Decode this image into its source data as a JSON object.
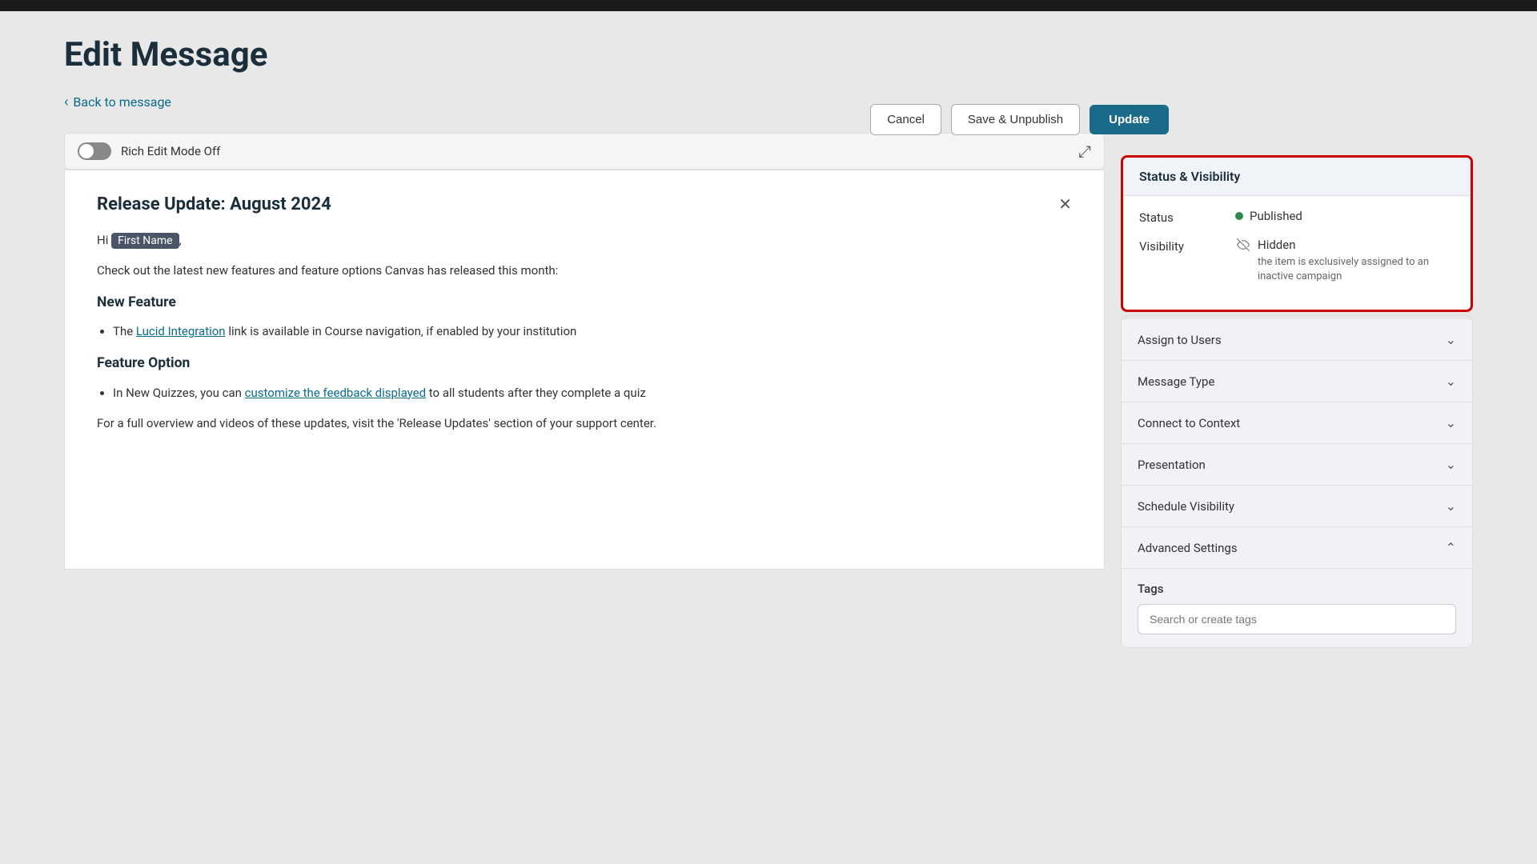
{
  "page": {
    "title": "Edit Message",
    "top_bar_bg": "#1a1a1a"
  },
  "header": {
    "back_link": "Back to message",
    "cancel_btn": "Cancel",
    "save_unpublish_btn": "Save & Unpublish",
    "update_btn": "Update"
  },
  "editor": {
    "rich_edit_label": "Rich Edit Mode Off",
    "expand_icon": "⤢"
  },
  "message": {
    "title": "Release Update: August 2024",
    "greeting": "Hi",
    "first_name_tag": "First Name",
    "body_intro": "Check out the latest new features and feature options Canvas has released this month:",
    "section1_title": "New Feature",
    "section1_bullet": "The link is available in Course navigation, if enabled by your institution",
    "section1_link_text": "Lucid Integration",
    "section2_title": "Feature Option",
    "section2_bullet_before": "In New Quizzes, you can",
    "section2_link_text": "customize the feedback displayed",
    "section2_bullet_after": "to all students after they complete a quiz",
    "footer_text": "For a full overview and videos of these updates, visit the 'Release Updates' section of your support center."
  },
  "sidebar": {
    "status_visibility": {
      "panel_title": "Status & Visibility",
      "status_label": "Status",
      "status_value": "Published",
      "visibility_label": "Visibility",
      "visibility_value": "Hidden",
      "visibility_subtext": "the item is exclusively assigned to an inactive campaign"
    },
    "accordion_items": [
      {
        "label": "Assign to Users",
        "expanded": false
      },
      {
        "label": "Message Type",
        "expanded": false
      },
      {
        "label": "Connect to Context",
        "expanded": false
      },
      {
        "label": "Presentation",
        "expanded": false
      },
      {
        "label": "Schedule Visibility",
        "expanded": false
      },
      {
        "label": "Advanced Settings",
        "expanded": true
      }
    ],
    "tags": {
      "label": "Tags",
      "placeholder": "Search or create tags"
    }
  }
}
